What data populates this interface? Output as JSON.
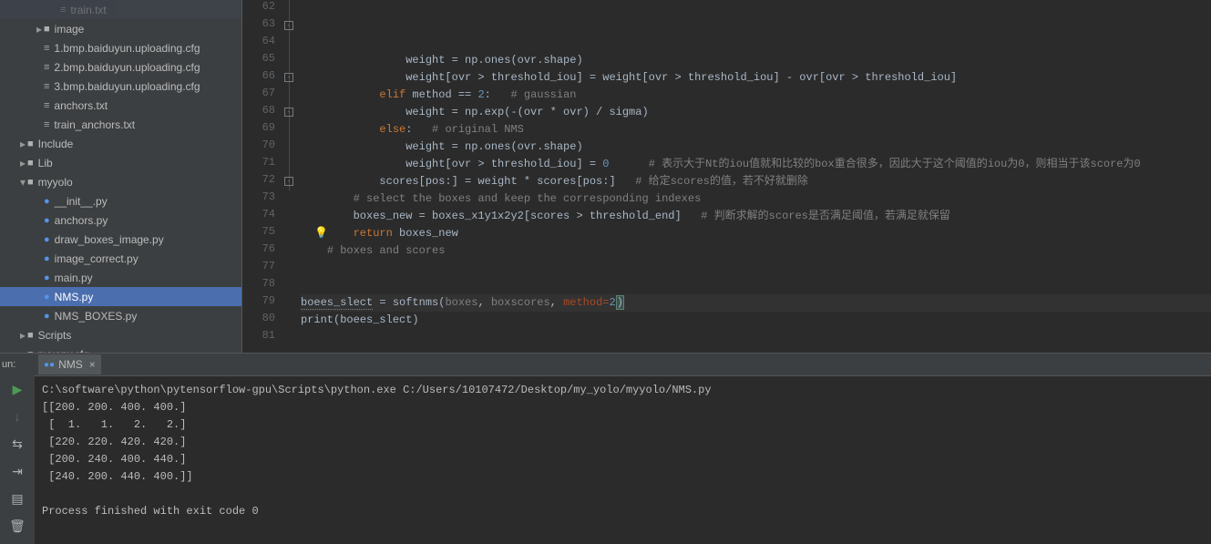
{
  "sidebar": {
    "items": [
      {
        "indent": 3,
        "icon": "file-cfg",
        "label": "train.txt",
        "dim": true
      },
      {
        "indent": 2,
        "chev": "right",
        "icon": "folder",
        "label": "image"
      },
      {
        "indent": 2,
        "icon": "file-cfg",
        "label": "1.bmp.baiduyun.uploading.cfg"
      },
      {
        "indent": 2,
        "icon": "file-cfg",
        "label": "2.bmp.baiduyun.uploading.cfg"
      },
      {
        "indent": 2,
        "icon": "file-cfg",
        "label": "3.bmp.baiduyun.uploading.cfg"
      },
      {
        "indent": 2,
        "icon": "file-txt",
        "label": "anchors.txt"
      },
      {
        "indent": 2,
        "icon": "file-txt",
        "label": "train_anchors.txt"
      },
      {
        "indent": 1,
        "chev": "right",
        "icon": "folder",
        "label": "Include"
      },
      {
        "indent": 1,
        "chev": "right",
        "icon": "folder",
        "label": "Lib"
      },
      {
        "indent": 1,
        "chev": "down",
        "icon": "folder",
        "label": "myyolo"
      },
      {
        "indent": 2,
        "icon": "file-py",
        "label": "__init__.py"
      },
      {
        "indent": 2,
        "icon": "file-py",
        "label": "anchors.py"
      },
      {
        "indent": 2,
        "icon": "file-py",
        "label": "draw_boxes_image.py"
      },
      {
        "indent": 2,
        "icon": "file-py",
        "label": "image_correct.py"
      },
      {
        "indent": 2,
        "icon": "file-py",
        "label": "main.py"
      },
      {
        "indent": 2,
        "icon": "file-py",
        "label": "NMS.py",
        "selected": true
      },
      {
        "indent": 2,
        "icon": "file-py",
        "label": "NMS_BOXES.py"
      },
      {
        "indent": 1,
        "chev": "right",
        "icon": "folder",
        "label": "Scripts"
      },
      {
        "indent": 1,
        "icon": "file-cfg",
        "label": "pyvenv.cfg"
      }
    ]
  },
  "editor": {
    "first_line": 62,
    "last_line": 81,
    "bulb_line": 75,
    "caret_line": 76,
    "tokens": {
      "62": [
        {
          "t": "                weight = np.ones(ovr.shape)",
          "c": ""
        }
      ],
      "63": [
        {
          "t": "                weight[ovr > threshold_iou] = weight[ovr > threshold_iou] - ovr[ovr > threshold_iou]",
          "c": ""
        }
      ],
      "64": [
        {
          "t": "            ",
          "c": ""
        },
        {
          "t": "elif",
          "c": "kw"
        },
        {
          "t": " method == ",
          "c": ""
        },
        {
          "t": "2",
          "c": "num"
        },
        {
          "t": ":",
          "c": ""
        },
        {
          "t": "   # gaussian",
          "c": "cm"
        }
      ],
      "65": [
        {
          "t": "                weight = np.exp(-(ovr * ovr) / sigma)",
          "c": ""
        }
      ],
      "66": [
        {
          "t": "            ",
          "c": ""
        },
        {
          "t": "else",
          "c": "kw"
        },
        {
          "t": ":",
          "c": ""
        },
        {
          "t": "   # original NMS",
          "c": "cm"
        }
      ],
      "67": [
        {
          "t": "                weight = np.ones(ovr.shape)",
          "c": ""
        }
      ],
      "68": [
        {
          "t": "                weight[ovr > threshold_iou] = ",
          "c": ""
        },
        {
          "t": "0",
          "c": "num"
        },
        {
          "t": "      ",
          "c": ""
        },
        {
          "t": "# 表示大于Nt的iou值就和比较的box重合很多，因此大于这个阈值的iou为0，则相当于该score为0",
          "c": "cm"
        }
      ],
      "69": [
        {
          "t": "            scores[pos:] = weight * scores[pos:]",
          "c": ""
        },
        {
          "t": "   # 给定scores的值，若不好就删除",
          "c": "cm"
        }
      ],
      "70": [
        {
          "t": "        ",
          "c": ""
        },
        {
          "t": "# select the boxes and keep the corresponding indexes",
          "c": "cm"
        }
      ],
      "71": [
        {
          "t": "        boxes_new = boxes_x1y1x2y2[scores > threshold_end]",
          "c": ""
        },
        {
          "t": "   # 判断求解的scores是否满足阈值，若满足就保留",
          "c": "cm"
        }
      ],
      "72": [
        {
          "t": "        ",
          "c": ""
        },
        {
          "t": "return",
          "c": "kw"
        },
        {
          "t": " boxes_new",
          "c": ""
        }
      ],
      "73": [
        {
          "t": "    ",
          "c": ""
        },
        {
          "t": "# boxes and scores",
          "c": "cm"
        }
      ],
      "74": [
        {
          "t": "",
          "c": ""
        }
      ],
      "75": [
        {
          "t": "",
          "c": ""
        }
      ],
      "76": [
        {
          "t": "boees_slect",
          "c": "warn"
        },
        {
          "t": " = softnms(",
          "c": ""
        },
        {
          "t": "boxes",
          "c": "cm"
        },
        {
          "t": ", ",
          "c": ""
        },
        {
          "t": "boxscores",
          "c": "cm"
        },
        {
          "t": ", ",
          "c": ""
        },
        {
          "t": "method=",
          "c": "par"
        },
        {
          "t": "2",
          "c": "num"
        },
        {
          "t": ")",
          "c": "caret-highlight"
        }
      ],
      "77": [
        {
          "t": "print",
          "c": ""
        },
        {
          "t": "(boees_slect)",
          "c": ""
        }
      ],
      "78": [
        {
          "t": "",
          "c": ""
        }
      ],
      "79": [
        {
          "t": "",
          "c": ""
        }
      ],
      "80": [
        {
          "t": "",
          "c": ""
        }
      ],
      "81": [
        {
          "t": "",
          "c": ""
        }
      ]
    },
    "fold_marks": [
      {
        "line": 63,
        "type": "close"
      },
      {
        "line": 66,
        "type": "close"
      },
      {
        "line": 68,
        "type": "close"
      },
      {
        "line": 72,
        "type": "close"
      }
    ]
  },
  "run": {
    "label": "un:",
    "tab_name": "NMS",
    "output": [
      "C:\\software\\python\\pytensorflow-gpu\\Scripts\\python.exe C:/Users/10107472/Desktop/my_yolo/myyolo/NMS.py",
      "[[200. 200. 400. 400.]",
      " [  1.   1.   2.   2.]",
      " [220. 220. 420. 420.]",
      " [200. 240. 400. 440.]",
      " [240. 200. 440. 400.]]",
      "",
      "Process finished with exit code 0"
    ]
  }
}
